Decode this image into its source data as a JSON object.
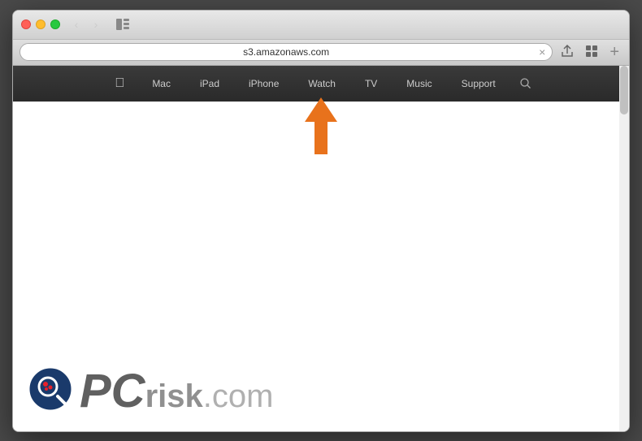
{
  "browser": {
    "tab_title": "s3.amazonaws.com",
    "address": "s3.amazonaws.com",
    "close_label": "×",
    "new_tab_label": "+"
  },
  "nav": {
    "items": [
      {
        "label": "Mac"
      },
      {
        "label": "iPad"
      },
      {
        "label": "iPhone"
      },
      {
        "label": "Watch"
      },
      {
        "label": "TV"
      },
      {
        "label": "Music"
      },
      {
        "label": "Support"
      }
    ],
    "search_icon": "🔍"
  },
  "watermark": {
    "pc_text": "PC",
    "risk_text": "risk",
    "domain": ".com"
  },
  "arrow": {
    "label": "↑",
    "color": "#e8721c"
  },
  "traffic_lights": {
    "close": "close",
    "minimize": "minimize",
    "maximize": "maximize"
  }
}
